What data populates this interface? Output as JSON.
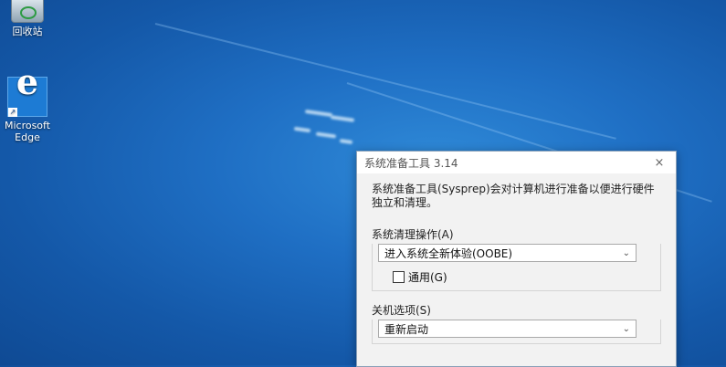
{
  "desktop": {
    "icons": [
      {
        "label": "回收站",
        "icon": "recycle-bin-icon"
      },
      {
        "label": "Microsoft Edge",
        "icon": "edge-icon"
      }
    ]
  },
  "dialog": {
    "title": "系统准备工具 3.14",
    "close_glyph": "×",
    "description": "系统准备工具(Sysprep)会对计算机进行准备以便进行硬件独立和清理。",
    "cleanup": {
      "label": "系统清理操作(A)",
      "selected": "进入系统全新体验(OOBE)",
      "checkbox_label": "通用(G)",
      "checkbox_checked": false
    },
    "shutdown": {
      "label": "关机选项(S)",
      "selected": "重新启动"
    }
  }
}
